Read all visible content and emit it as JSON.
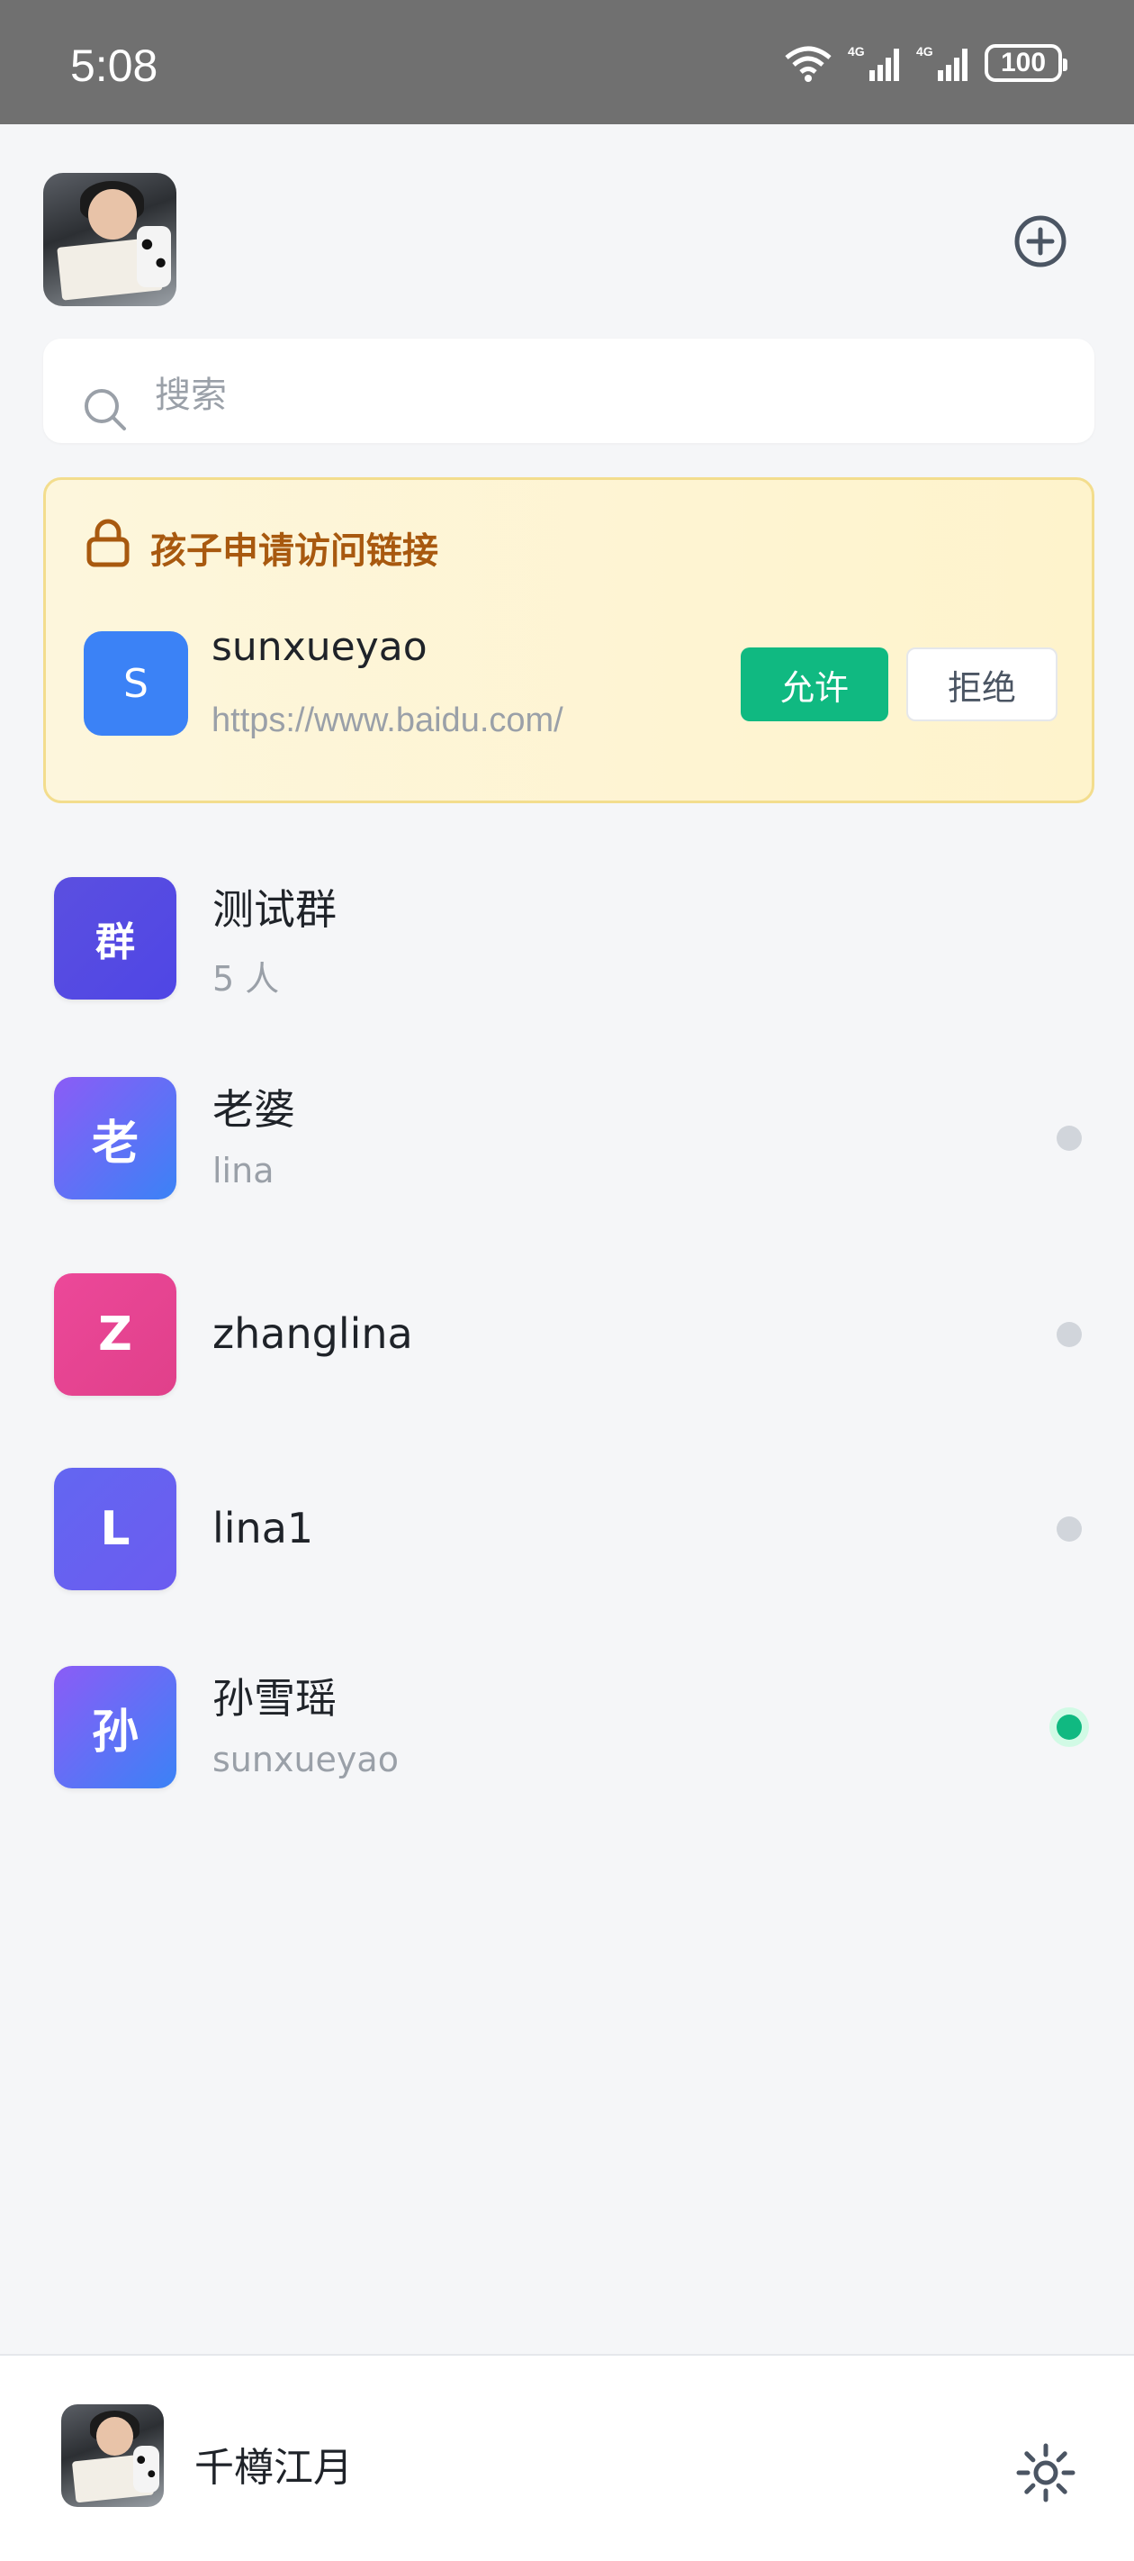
{
  "status_bar": {
    "time": "5:08",
    "battery": "100",
    "icons": [
      "wifi-icon",
      "signal-4g-icon",
      "signal-4g-icon",
      "battery-icon"
    ]
  },
  "header": {
    "add_icon": "plus-circle-icon"
  },
  "search": {
    "placeholder": "搜索",
    "icon": "search-icon"
  },
  "request_card": {
    "title": "孩子申请访问链接",
    "icon": "lock-icon",
    "avatar_letter": "S",
    "username": "sunxueyao",
    "url": "https://www.baidu.com/",
    "allow_label": "允许",
    "deny_label": "拒绝",
    "accent_color": "#a8590f"
  },
  "contacts": [
    {
      "avatar": "群",
      "name": "测试群",
      "sub": "5 人",
      "status": "none",
      "color": "#4f46e5"
    },
    {
      "avatar": "老",
      "name": "老婆",
      "sub": "lina",
      "status": "offline",
      "color": "#6366f1"
    },
    {
      "avatar": "Z",
      "name": "zhanglina",
      "sub": "",
      "status": "offline",
      "color": "#ec4899"
    },
    {
      "avatar": "L",
      "name": "lina1",
      "sub": "",
      "status": "offline",
      "color": "#6366f1"
    },
    {
      "avatar": "孙",
      "name": "孙雪瑶",
      "sub": "sunxueyao",
      "status": "online",
      "color": "#7c6cf2"
    }
  ],
  "footer": {
    "username": "千樽江月",
    "settings_icon": "gear-icon"
  }
}
